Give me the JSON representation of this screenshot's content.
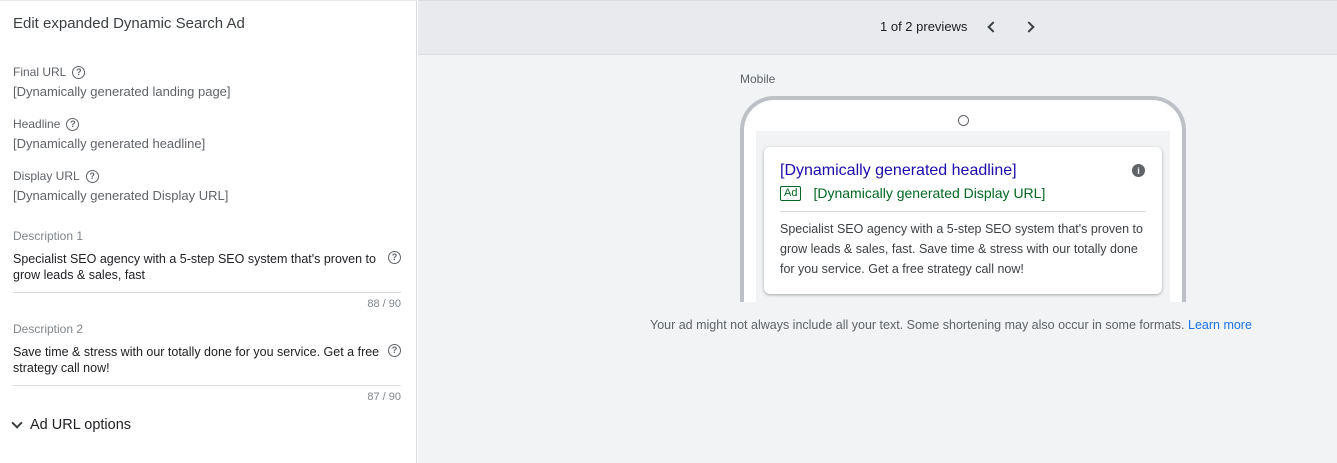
{
  "editor": {
    "title": "Edit expanded Dynamic Search Ad",
    "final_url": {
      "label": "Final URL",
      "value": "[Dynamically generated landing page]"
    },
    "headline": {
      "label": "Headline",
      "value": "[Dynamically generated headline]"
    },
    "display_url": {
      "label": "Display URL",
      "value": "[Dynamically generated Display URL]"
    },
    "description1": {
      "label": "Description 1",
      "value": "Specialist SEO agency with a 5-step SEO system that's proven to grow leads & sales, fast",
      "counter": "88 / 90"
    },
    "description2": {
      "label": "Description 2",
      "value": "Save time & stress with our totally done for you service. Get a free strategy call now!",
      "counter": "87 / 90"
    },
    "url_options_label": "Ad URL options",
    "help_glyph": "?"
  },
  "preview": {
    "count": "1 of 2 previews",
    "device": "Mobile",
    "ad": {
      "headline": "[Dynamically generated headline]",
      "badge": "Ad",
      "display_url": "[Dynamically generated Display URL]",
      "description": "Specialist SEO agency with a 5-step SEO system that's proven to grow leads & sales, fast. Save time & stress with our totally done for you service. Get a free strategy call now!",
      "info_glyph": "i"
    },
    "disclaimer": "Your ad might not always include all your text. Some shortening may also occur in some formats.",
    "learn_more": "Learn more"
  },
  "colors": {
    "headline_link": "#1a0dab",
    "display_url_green": "#006621",
    "learn_more_blue": "#1a73e8"
  }
}
